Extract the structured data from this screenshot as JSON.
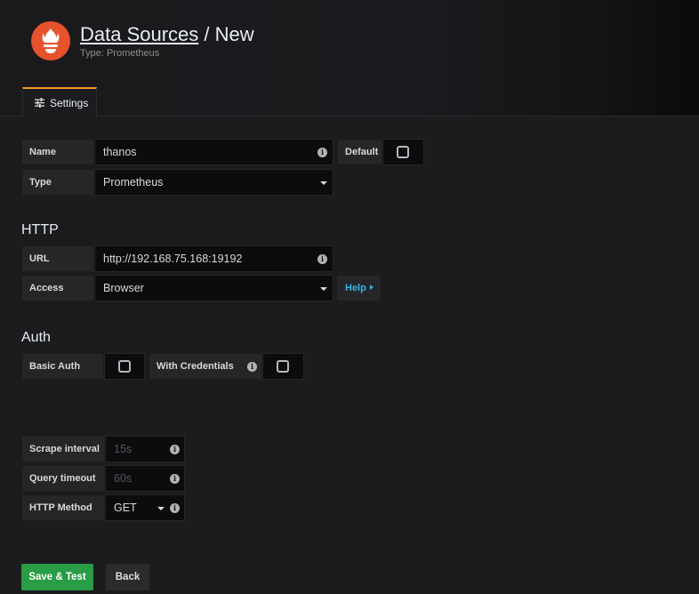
{
  "header": {
    "title_link": "Data Sources",
    "title_rest": " / New",
    "subtitle": "Type: Prometheus",
    "logo_icon": "prometheus-flame-icon"
  },
  "tabs": [
    {
      "label": "Settings",
      "icon": "sliders-icon",
      "active": true
    }
  ],
  "basic": {
    "name_label": "Name",
    "name_value": "thanos",
    "default_label": "Default",
    "default_checked": false,
    "type_label": "Type",
    "type_value": "Prometheus"
  },
  "http": {
    "heading": "HTTP",
    "url_label": "URL",
    "url_value": "http://192.168.75.168:19192",
    "access_label": "Access",
    "access_value": "Browser",
    "help_label": "Help"
  },
  "auth": {
    "heading": "Auth",
    "basic_auth_label": "Basic Auth",
    "basic_auth_checked": false,
    "with_credentials_label": "With Credentials",
    "with_credentials_checked": false
  },
  "prometheus": {
    "scrape_interval_label": "Scrape interval",
    "scrape_interval_placeholder": "15s",
    "query_timeout_label": "Query timeout",
    "query_timeout_placeholder": "60s",
    "http_method_label": "HTTP Method",
    "http_method_value": "GET"
  },
  "actions": {
    "save_label": "Save & Test",
    "back_label": "Back"
  },
  "colors": {
    "accent_tab": "#f79520",
    "save_button": "#299c46",
    "help_link": "#33b5e5",
    "logo": "#e6522c"
  }
}
